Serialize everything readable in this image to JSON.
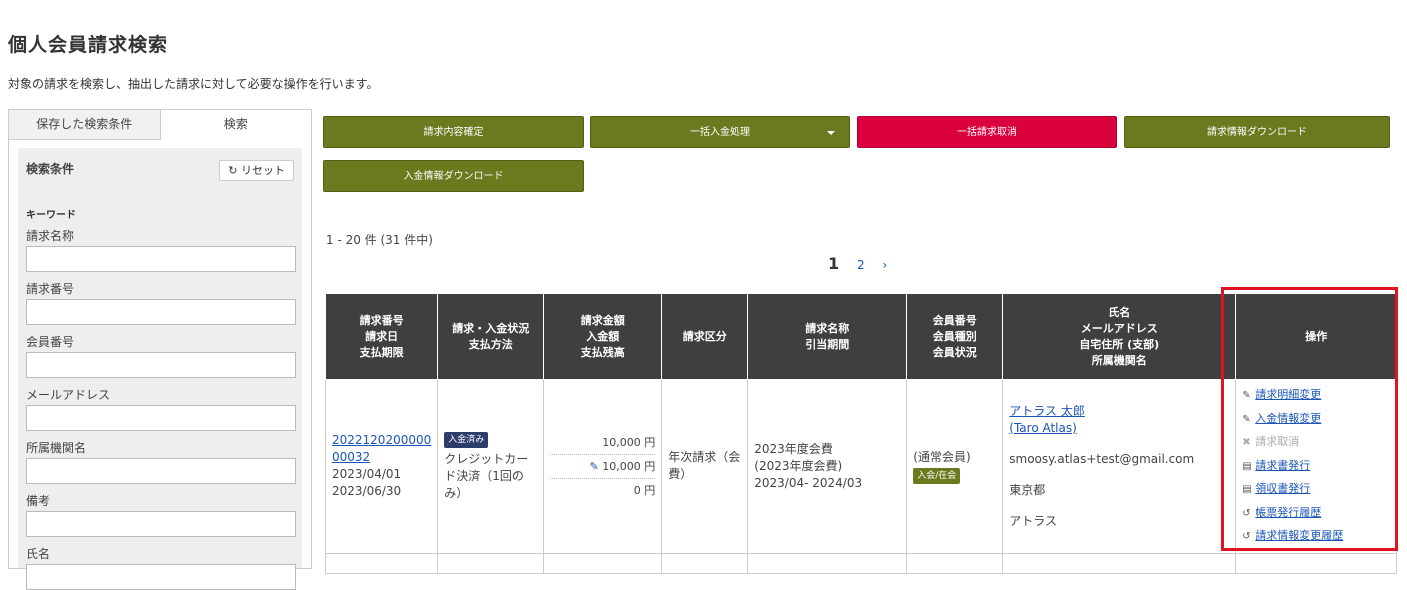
{
  "page": {
    "title": "個人会員請求検索",
    "description": "対象の請求を検索し、抽出した請求に対して必要な操作を行います。"
  },
  "sidebar": {
    "tabs": [
      {
        "label": "保存した検索条件"
      },
      {
        "label": "検索"
      }
    ],
    "conditions_title": "検索条件",
    "reset_label": "リセット",
    "keyword_label": "キーワード",
    "fields": [
      {
        "label": "請求名称",
        "value": ""
      },
      {
        "label": "請求番号",
        "value": ""
      },
      {
        "label": "会員番号",
        "value": ""
      },
      {
        "label": "メールアドレス",
        "value": ""
      },
      {
        "label": "所属機関名",
        "value": ""
      },
      {
        "label": "備考",
        "value": ""
      },
      {
        "label": "氏名",
        "value": ""
      }
    ]
  },
  "actions": {
    "confirm": "請求内容確定",
    "bulk_payment": "一括入金処理",
    "bulk_cancel": "一括請求取消",
    "download_billing": "請求情報ダウンロード",
    "download_payment": "入金情報ダウンロード"
  },
  "colors": {
    "olive": "#6b7a1e",
    "red": "#d9003d",
    "header": "#3f3f3f",
    "highlight": "#e01420"
  },
  "results": {
    "count_text": "1 - 20 件 (31 件中)",
    "pager": {
      "current": "1",
      "next_page": "2",
      "next": "›"
    },
    "headers": {
      "col1": [
        "請求番号",
        "請求日",
        "支払期限"
      ],
      "col2": [
        "請求・入金状況",
        "支払方法"
      ],
      "col3": [
        "請求金額",
        "入金額",
        "支払残高"
      ],
      "col4": [
        "請求区分"
      ],
      "col5": [
        "請求名称",
        "引当期間"
      ],
      "col6": [
        "会員番号",
        "会員種別",
        "会員状況"
      ],
      "col7": [
        "氏名",
        "メールアドレス",
        "自宅住所 (支部)",
        "所属機関名"
      ],
      "col8": [
        "操作"
      ]
    },
    "rows": [
      {
        "invoice_no": "2022120200000 00032",
        "invoice_date": "2023/04/01",
        "due_date": "2023/06/30",
        "status_badge": "入金済み",
        "payment_method": "クレジットカード決済（1回のみ）",
        "amount": "10,000 円",
        "paid": "10,000 円",
        "balance": "0 円",
        "category": "年次請求（会費）",
        "billing_name": "2023年度会費",
        "billing_name_sub": "(2023年度会費)",
        "period": "2023/04- 2024/03",
        "member_type": "(通常会員)",
        "member_status": "入会/在会",
        "name": "アトラス 太郎",
        "name_en": "(Taro Atlas)",
        "email": "smoosy.atlas+test@gmail.com",
        "address": "東京都",
        "org": "アトラス",
        "ops": {
          "edit_detail": "請求明細変更",
          "edit_payment": "入金情報変更",
          "cancel": "請求取消",
          "issue_invoice": "請求書発行",
          "issue_receipt": "領収書発行",
          "form_history": "帳票発行履歴",
          "change_history": "請求情報変更履歴"
        }
      }
    ]
  }
}
